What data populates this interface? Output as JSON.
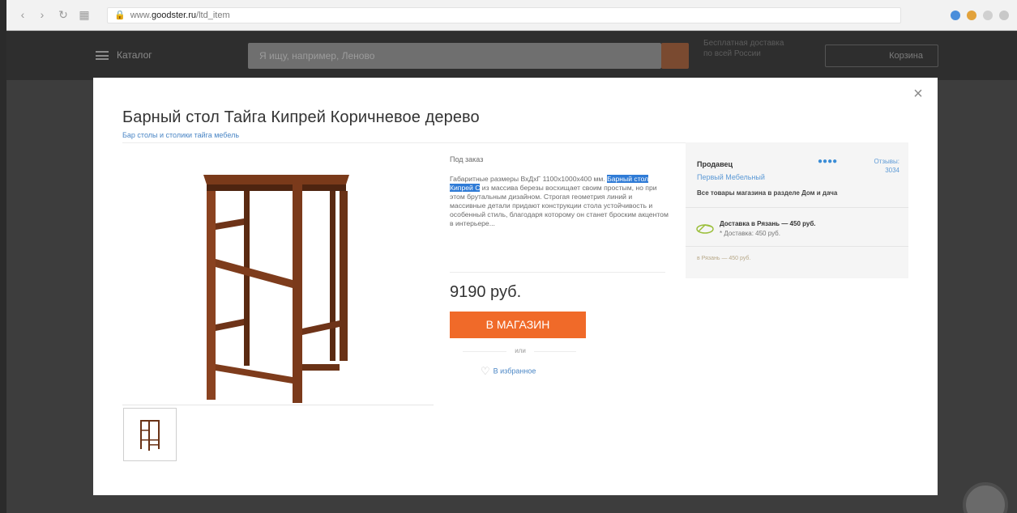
{
  "browser": {
    "url_prefix": "www.",
    "url_domain": "goodster.ru",
    "url_path": "/ltd_item"
  },
  "site_header": {
    "catalog_label": "Каталог",
    "search_placeholder": "Я ищу, например, Леново",
    "info_lines": [
      "Бесплатная доставка",
      "по всей России"
    ],
    "cart_label": "Корзина"
  },
  "modal": {
    "close_glyph": "×",
    "title": "Барный стол Тайга Кипрей Коричневое дерево",
    "category_link": "Бар столы и столики тайга мебель",
    "availability": "Под заказ",
    "description_before": "Габаритные размеры ВхДхГ 1100х1000х400 мм.",
    "description_highlight": "Барный стол Кипрей С",
    "description_after": " из массива березы восхищает своим простым, но при этом брутальным дизайном. Строгая геометрия линий и массивные детали придают конструкции стола устойчивость и особенный стиль, благодаря которому он станет броским акцентом в интерьере...",
    "price": "9190 руб.",
    "buy_button": "В МАГАЗИН",
    "or_text": "или",
    "favorite_link": "В избранное",
    "seller": {
      "heading": "Продавец",
      "rating": "●●●●",
      "reviews_link": "Отзывы: 3034",
      "name": "Первый Мебельный",
      "note": "Все товары магазина в разделе Дом и дача",
      "delivery_title": "Доставка в Рязань — 450 руб.",
      "delivery_sub": "* Доставка: 450 руб.",
      "delivery_link": "в Рязань — 450 руб."
    }
  }
}
